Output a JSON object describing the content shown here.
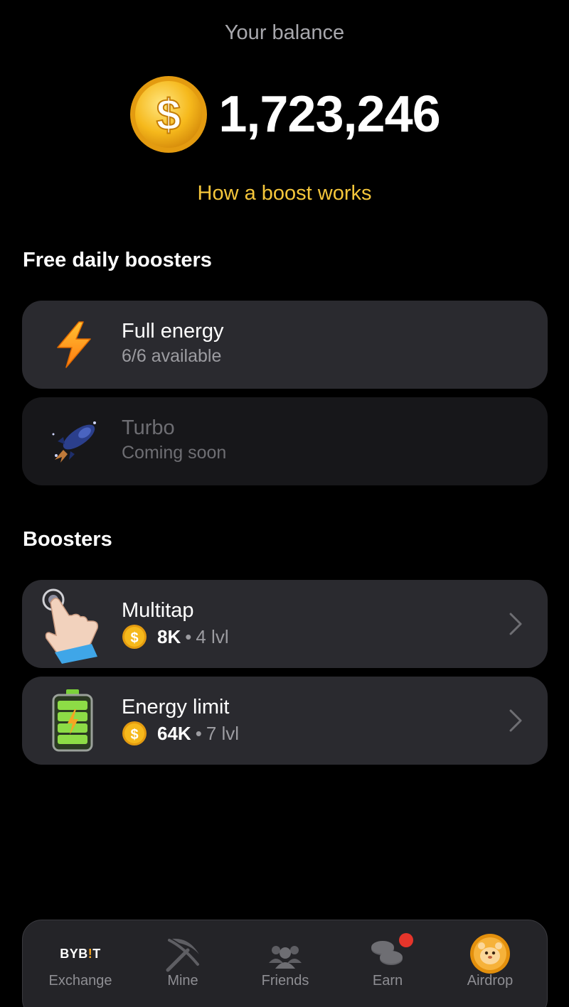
{
  "header": {
    "balance_label": "Your balance",
    "balance_value": "1,723,246",
    "how_link": "How a boost works"
  },
  "free_section": {
    "title": "Free daily boosters",
    "items": [
      {
        "title": "Full energy",
        "subtitle": "6/6 available",
        "icon": "lightning-icon"
      },
      {
        "title": "Turbo",
        "subtitle": "Coming soon",
        "icon": "rocket-icon"
      }
    ]
  },
  "boosters_section": {
    "title": "Boosters",
    "items": [
      {
        "title": "Multitap",
        "price": "8K",
        "separator": "•",
        "level": "4 lvl",
        "icon": "tapping-hand-icon"
      },
      {
        "title": "Energy limit",
        "price": "64K",
        "separator": "•",
        "level": "7 lvl",
        "icon": "battery-icon"
      }
    ]
  },
  "nav": {
    "items": [
      {
        "label": "Exchange",
        "icon": "bybit-logo",
        "logo_text_1": "BYB",
        "logo_text_2": "!",
        "logo_text_3": "T"
      },
      {
        "label": "Mine",
        "icon": "pickaxe-icon"
      },
      {
        "label": "Friends",
        "icon": "friends-icon"
      },
      {
        "label": "Earn",
        "icon": "coins-icon"
      },
      {
        "label": "Airdrop",
        "icon": "hamster-coin-icon"
      }
    ]
  },
  "colors": {
    "background": "#000000",
    "card": "#2a2a2f",
    "card_disabled": "#17171a",
    "accent_yellow": "#f5c63b",
    "notification": "#e5352b"
  }
}
